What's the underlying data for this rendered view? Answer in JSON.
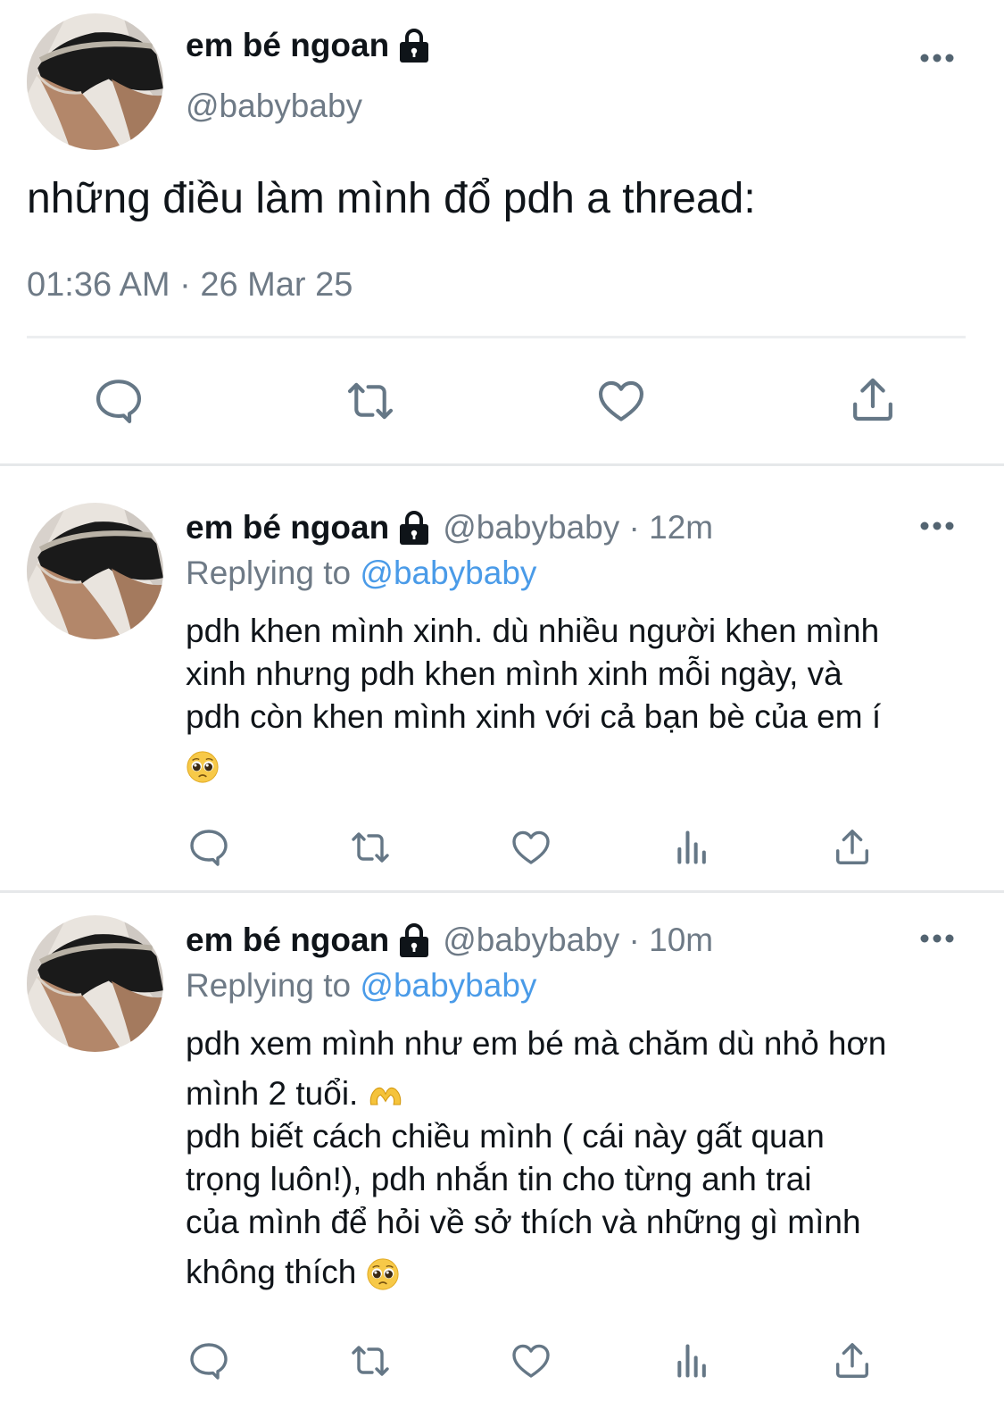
{
  "main": {
    "name": "em bé ngoan",
    "handle": "@babybaby",
    "text": "những điều làm mình đổ pdh a thread:",
    "timestamp": "01:36 AM · 26 Mar 25"
  },
  "replies": [
    {
      "name": "em bé ngoan",
      "meta": "@babybaby · 12m",
      "replying_prefix": "Replying to ",
      "replying_to": "@babybaby",
      "lines": [
        "pdh khen mình xinh. dù nhiều người khen mình",
        "xinh nhưng pdh khen mình xinh mỗi ngày, và",
        "pdh còn khen mình xinh với cả bạn bè của em í"
      ],
      "emoji": "pleading-face"
    },
    {
      "name": "em bé ngoan",
      "meta": "@babybaby · 10m",
      "replying_prefix": "Replying to ",
      "replying_to": "@babybaby",
      "line1": "pdh xem mình như em bé mà chăm dù nhỏ hơn",
      "line2": "mình 2 tuổi.",
      "emoji2": "heart-hands",
      "lines": [
        "pdh biết cách chiều mình ( cái này gất quan",
        "trọng luôn!), pdh nhắn tin cho từng anh trai",
        "của mình để hỏi về sở thích và những gì mình"
      ],
      "line_last": "không thích",
      "emoji_last": "pleading-face"
    }
  ],
  "icons": {
    "reply": "reply-icon",
    "retweet": "retweet-icon",
    "like": "heart-icon",
    "views": "views-icon",
    "share": "share-icon",
    "more": "more-icon",
    "lock": "lock-icon"
  },
  "colors": {
    "link": "#4a9be8",
    "muted": "#6e7a86",
    "icon": "#657786"
  }
}
